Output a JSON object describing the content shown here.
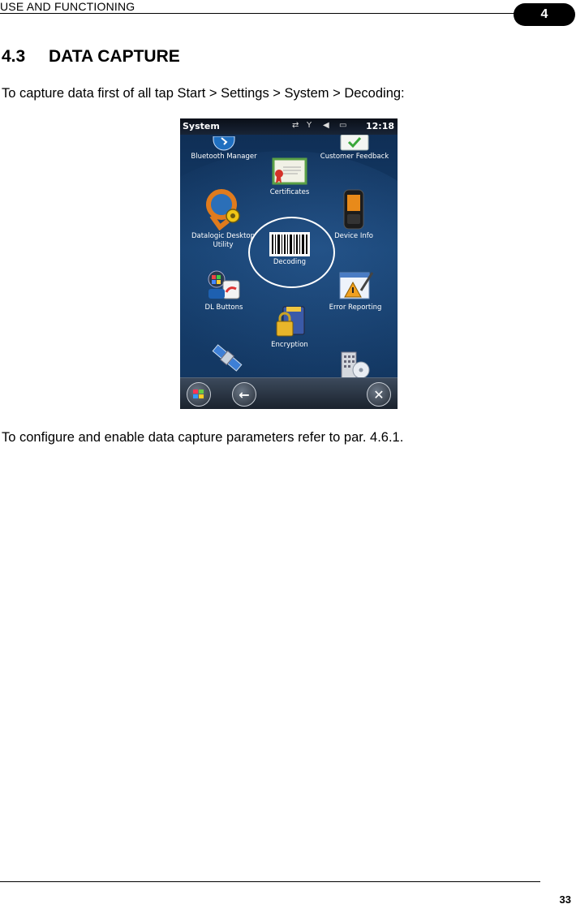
{
  "header": {
    "running_title": "USE AND FUNCTIONING",
    "chapter": "4"
  },
  "section": {
    "number": "4.3",
    "title": "DATA CAPTURE"
  },
  "paragraphs": {
    "intro": "To capture data first of all tap Start > Settings > System > Decoding:",
    "outro": "To configure and enable data capture parameters refer to par. 4.6.1."
  },
  "screenshot": {
    "status": {
      "title": "System",
      "time": "12:18"
    },
    "tiles": {
      "bluetooth": "Bluetooth Manager",
      "feedback": "Customer Feedback",
      "certificates": "Certificates",
      "datalogic_line1": "Datalogic Desktop",
      "datalogic_line2": "Utility",
      "device_info": "Device Info",
      "decoding": "Decoding",
      "dl_buttons": "DL Buttons",
      "error_reporting": "Error Reporting",
      "encryption": "Encryption"
    },
    "highlighted_item": "Decoding"
  },
  "footer": {
    "page_number": "33"
  }
}
